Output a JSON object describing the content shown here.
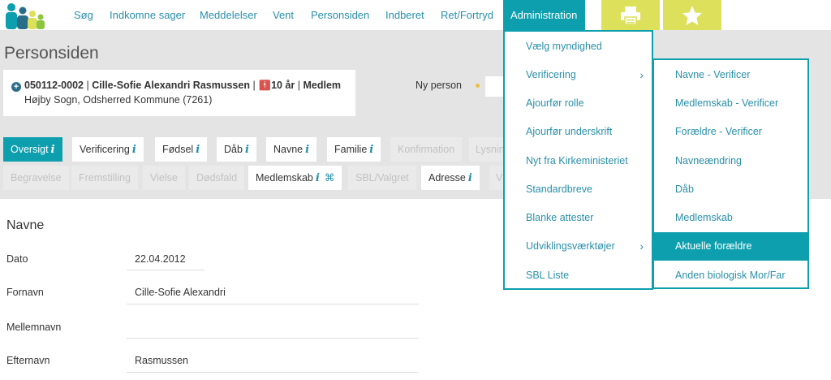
{
  "topnav": {
    "items": [
      {
        "label": "Søg"
      },
      {
        "label": "Indkomne sager"
      },
      {
        "label": "Meddelelser"
      },
      {
        "label": "Vent"
      },
      {
        "label": "Personsiden"
      },
      {
        "label": "Indberet"
      },
      {
        "label": "Ret/Fortryd"
      },
      {
        "label": "Administration"
      }
    ],
    "print_icon": "print-icon",
    "star_icon": "star-icon"
  },
  "page": {
    "title": "Personsiden"
  },
  "person": {
    "id": "050112-0002",
    "name": "Cille-Sofie Alexandri Rasmussen",
    "age": "10 år",
    "status": "Medlem",
    "parish": "Højby Sogn, Odsherred Kommune (7261)",
    "sep": "|"
  },
  "ny_person": {
    "label": "Ny person"
  },
  "tabs": [
    {
      "label": "Oversigt",
      "state": "active",
      "info": "i"
    },
    {
      "label": "Verificering",
      "state": "normal",
      "info": "i"
    },
    {
      "label": "Fødsel",
      "state": "normal",
      "info": "i"
    },
    {
      "label": "Dåb",
      "state": "normal",
      "info": "i"
    },
    {
      "label": "Navne",
      "state": "normal",
      "info": "i"
    },
    {
      "label": "Familie",
      "state": "normal",
      "info": "i"
    },
    {
      "label": "Konfirmation",
      "state": "disabled"
    },
    {
      "label": "Lysnin",
      "state": "disabled"
    },
    {
      "label": "Begravelse",
      "state": "disabled"
    },
    {
      "label": "Fremstilling",
      "state": "disabled"
    },
    {
      "label": "Vielse",
      "state": "disabled"
    },
    {
      "label": "Dødsfald",
      "state": "disabled"
    },
    {
      "label": "Medlemskab",
      "state": "normal",
      "info": "i",
      "cmd": "⌘"
    },
    {
      "label": "SBL/Valgret",
      "state": "disabled"
    },
    {
      "label": "Adresse",
      "state": "normal",
      "info": "i"
    },
    {
      "label": "V",
      "state": "disabled"
    }
  ],
  "navne": {
    "title": "Navne",
    "rows": [
      {
        "label": "Dato",
        "value": "22.04.2012"
      },
      {
        "label": "Fornavn",
        "value": "Cille-Sofie Alexandri"
      },
      {
        "label": "Mellemnavn",
        "value": ""
      },
      {
        "label": "Efternavn",
        "value": "Rasmussen"
      }
    ]
  },
  "admin_menu": {
    "items": [
      {
        "label": "Vælg myndighed"
      },
      {
        "label": "Verificering",
        "submenu": true
      },
      {
        "label": "Ajourfør rolle"
      },
      {
        "label": "Ajourfør underskrift"
      },
      {
        "label": "Nyt fra Kirkeministeriet"
      },
      {
        "label": "Standardbreve"
      },
      {
        "label": "Blanke attester"
      },
      {
        "label": "Udviklingsværktøjer",
        "submenu": true
      },
      {
        "label": "SBL Liste"
      }
    ]
  },
  "verificering_menu": {
    "items": [
      {
        "label": "Navne - Verificer"
      },
      {
        "label": "Medlemskab - Verificer"
      },
      {
        "label": "Forældre - Verificer"
      },
      {
        "label": "Navneændring"
      },
      {
        "label": "Dåb"
      },
      {
        "label": "Medlemskab"
      },
      {
        "label": "Aktuelle forældre",
        "highlight": true
      },
      {
        "label": "Anden biologisk Mor/Far"
      }
    ]
  },
  "colors": {
    "accent": "#0e9fae",
    "link": "#2a8fa8",
    "yellow": "#dce05a",
    "background": "#e4e4e4"
  }
}
